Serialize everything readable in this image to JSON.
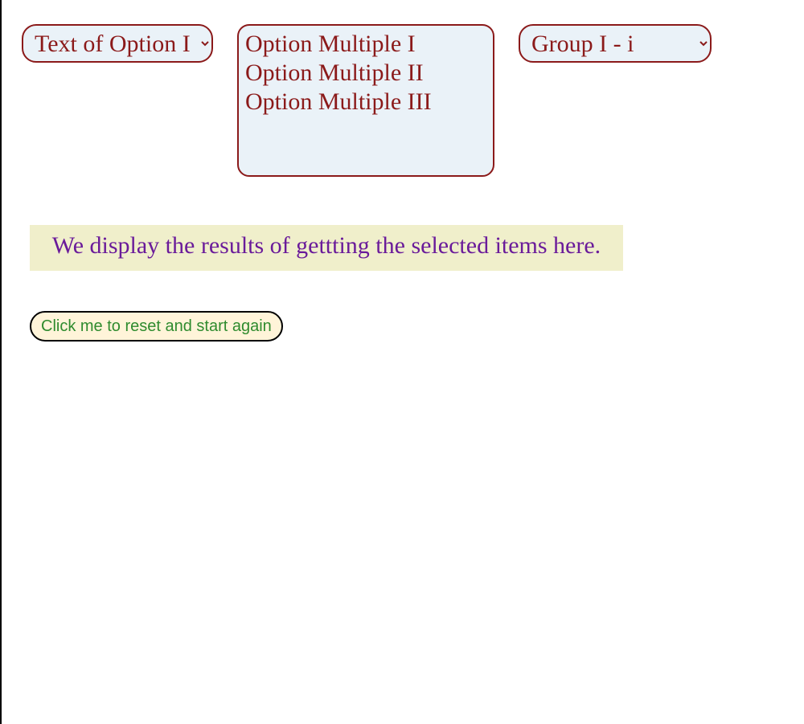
{
  "selects": {
    "single1": {
      "selected": "Text of Option I",
      "options": [
        "Text of Option I"
      ]
    },
    "multiple": {
      "options": [
        "Option Multiple I",
        "Option Multiple II",
        "Option Multiple III"
      ]
    },
    "single2": {
      "selected": "Group I - i",
      "options": [
        "Group I - i"
      ]
    }
  },
  "results_text": "We display the results of gettting the selected items here.",
  "reset_button_label": "Click me to reset and start again"
}
